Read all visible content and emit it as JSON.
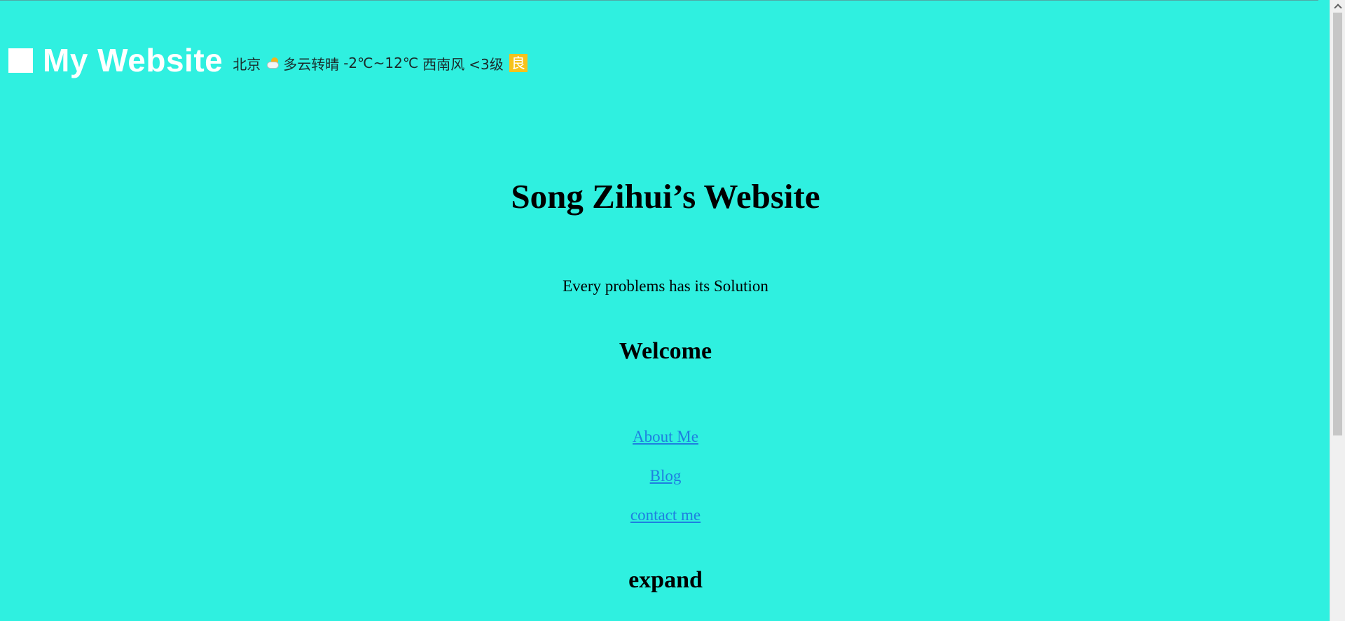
{
  "header": {
    "site_title": "My Website",
    "logo_icon": "square-logo-icon",
    "weather": {
      "city": "北京",
      "icon": "partly-cloudy-icon",
      "condition": "多云转晴",
      "temperature": "-2℃~12℃",
      "wind": "西南风",
      "wind_level": "<3级",
      "aqi": "良",
      "aqi_color": "#f6c21c"
    }
  },
  "main": {
    "title": "Song Zihui’s Website",
    "tagline": "Every problems has its Solution",
    "welcome": "Welcome",
    "links": {
      "about": "About Me",
      "blog": "Blog",
      "contact": "contact me"
    },
    "expand": "expand"
  },
  "colors": {
    "background": "#2ff0e0",
    "link": "#1e7fe0",
    "title": "#ffffff"
  }
}
